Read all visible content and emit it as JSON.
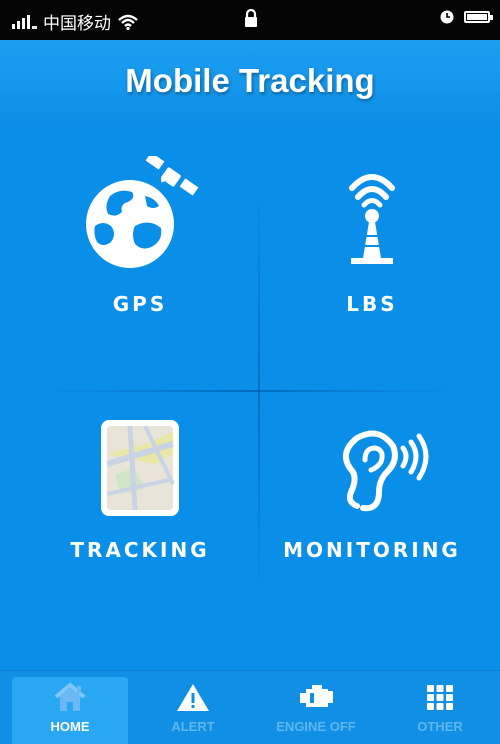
{
  "status_bar": {
    "carrier": "中国移动"
  },
  "header": {
    "title": "Mobile Tracking"
  },
  "menu": {
    "items": [
      {
        "label": "GPS",
        "icon": "globe-satellite-icon"
      },
      {
        "label": "LBS",
        "icon": "cell-tower-icon"
      },
      {
        "label": "TRACKING",
        "icon": "map-icon"
      },
      {
        "label": "MONITORING",
        "icon": "ear-icon"
      }
    ]
  },
  "tabbar": {
    "tabs": [
      {
        "label": "HOME",
        "icon": "home-icon",
        "active": true
      },
      {
        "label": "ALERT",
        "icon": "warning-icon",
        "active": false
      },
      {
        "label": "ENGINE OFF",
        "icon": "engine-icon",
        "active": false
      },
      {
        "label": "OTHER",
        "icon": "grid-icon",
        "active": false
      }
    ]
  },
  "colors": {
    "background": "#0a8fe8",
    "status_bar": "#050505",
    "active_tab": "#2aa7f2",
    "inactive_tab_label": "#5fb6ee",
    "text": "#ffffff"
  }
}
